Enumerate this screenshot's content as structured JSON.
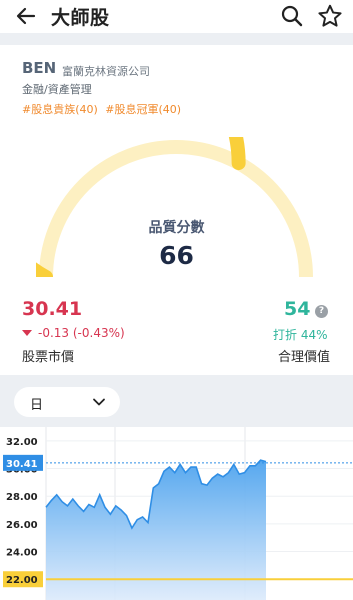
{
  "header": {
    "title": "大師股",
    "back_icon": "arrow-left-icon",
    "search_icon": "search-icon",
    "star_icon": "star-outline-icon"
  },
  "stock": {
    "ticker": "BEN",
    "company": "富蘭克林資源公司",
    "sector": "金融/資產管理",
    "tags": [
      "#股息貴族(40)",
      "#股息冠軍(40)"
    ]
  },
  "quality": {
    "label": "品質分數",
    "score": "66",
    "score_fraction": 0.66
  },
  "price": {
    "value": "30.41",
    "change": "-0.13 (-0.43%)",
    "label": "股票市價"
  },
  "fair_value": {
    "value": "54",
    "discount": "打折 44%",
    "label": "合理價值"
  },
  "period": {
    "selected": "日"
  },
  "colors": {
    "gauge": "#f9cf3a",
    "gauge_track": "#fdf0c2",
    "down": "#d73550",
    "fair": "#2fb59c",
    "line": "#2f8ee5",
    "price_tag": "#2f8ee5",
    "fair_tag": "#f9cf3a"
  },
  "chart_data": {
    "type": "area",
    "y_ticks": [
      "32.00",
      "30.00",
      "28.00",
      "26.00",
      "24.00",
      "22.00"
    ],
    "ylim": [
      20.5,
      33
    ],
    "price_tag": "30.41",
    "fair_tag": "22.00",
    "values": [
      27.2,
      27.7,
      28.1,
      27.6,
      27.3,
      27.8,
      27.3,
      26.9,
      27.4,
      27.2,
      28.1,
      27.2,
      26.7,
      27.3,
      27.0,
      26.6,
      25.7,
      26.3,
      26.5,
      26.1,
      28.6,
      28.9,
      29.8,
      30.1,
      29.7,
      30.3,
      29.7,
      30.1,
      30.1,
      28.9,
      28.8,
      29.3,
      29.6,
      29.4,
      29.7,
      30.3,
      29.6,
      29.7,
      30.2,
      30.2,
      30.6,
      30.5
    ]
  }
}
